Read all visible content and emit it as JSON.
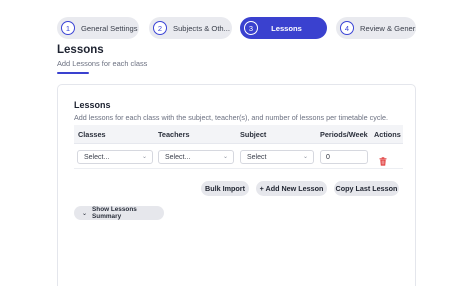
{
  "stepper": {
    "steps": [
      {
        "number": "1",
        "label": "General Settings"
      },
      {
        "number": "2",
        "label": "Subjects & Oth..."
      },
      {
        "number": "3",
        "label": "Lessons"
      },
      {
        "number": "4",
        "label": "Review & Gener..."
      }
    ],
    "active_step": "3"
  },
  "page": {
    "title": "Lessons",
    "subtitle": "Add Lessons for each class"
  },
  "card": {
    "title": "Lessons",
    "description": "Add lessons for each class with the subject, teacher(s), and number of lessons per timetable cycle.",
    "table": {
      "columns": [
        "Classes",
        "Teachers",
        "Subject",
        "Periods/Week",
        "Actions"
      ],
      "rows": [
        {
          "classes": "Select...",
          "teachers": "Select...",
          "subject": "Select",
          "periods": "0"
        }
      ]
    },
    "buttons": {
      "bulk_import": "Bulk Import",
      "add_new_lesson": "+ Add New Lesson",
      "copy_last_lesson": "Copy Last Lesson"
    },
    "summary_toggle": "Show Lessons Summary"
  },
  "icons": {
    "select_chevron": "chevron-down-icon",
    "delete": "trash-icon",
    "summary_chevron": "chevron-down-icon"
  },
  "colors": {
    "accent": "#3a41cf",
    "delete": "#e03b3b"
  }
}
